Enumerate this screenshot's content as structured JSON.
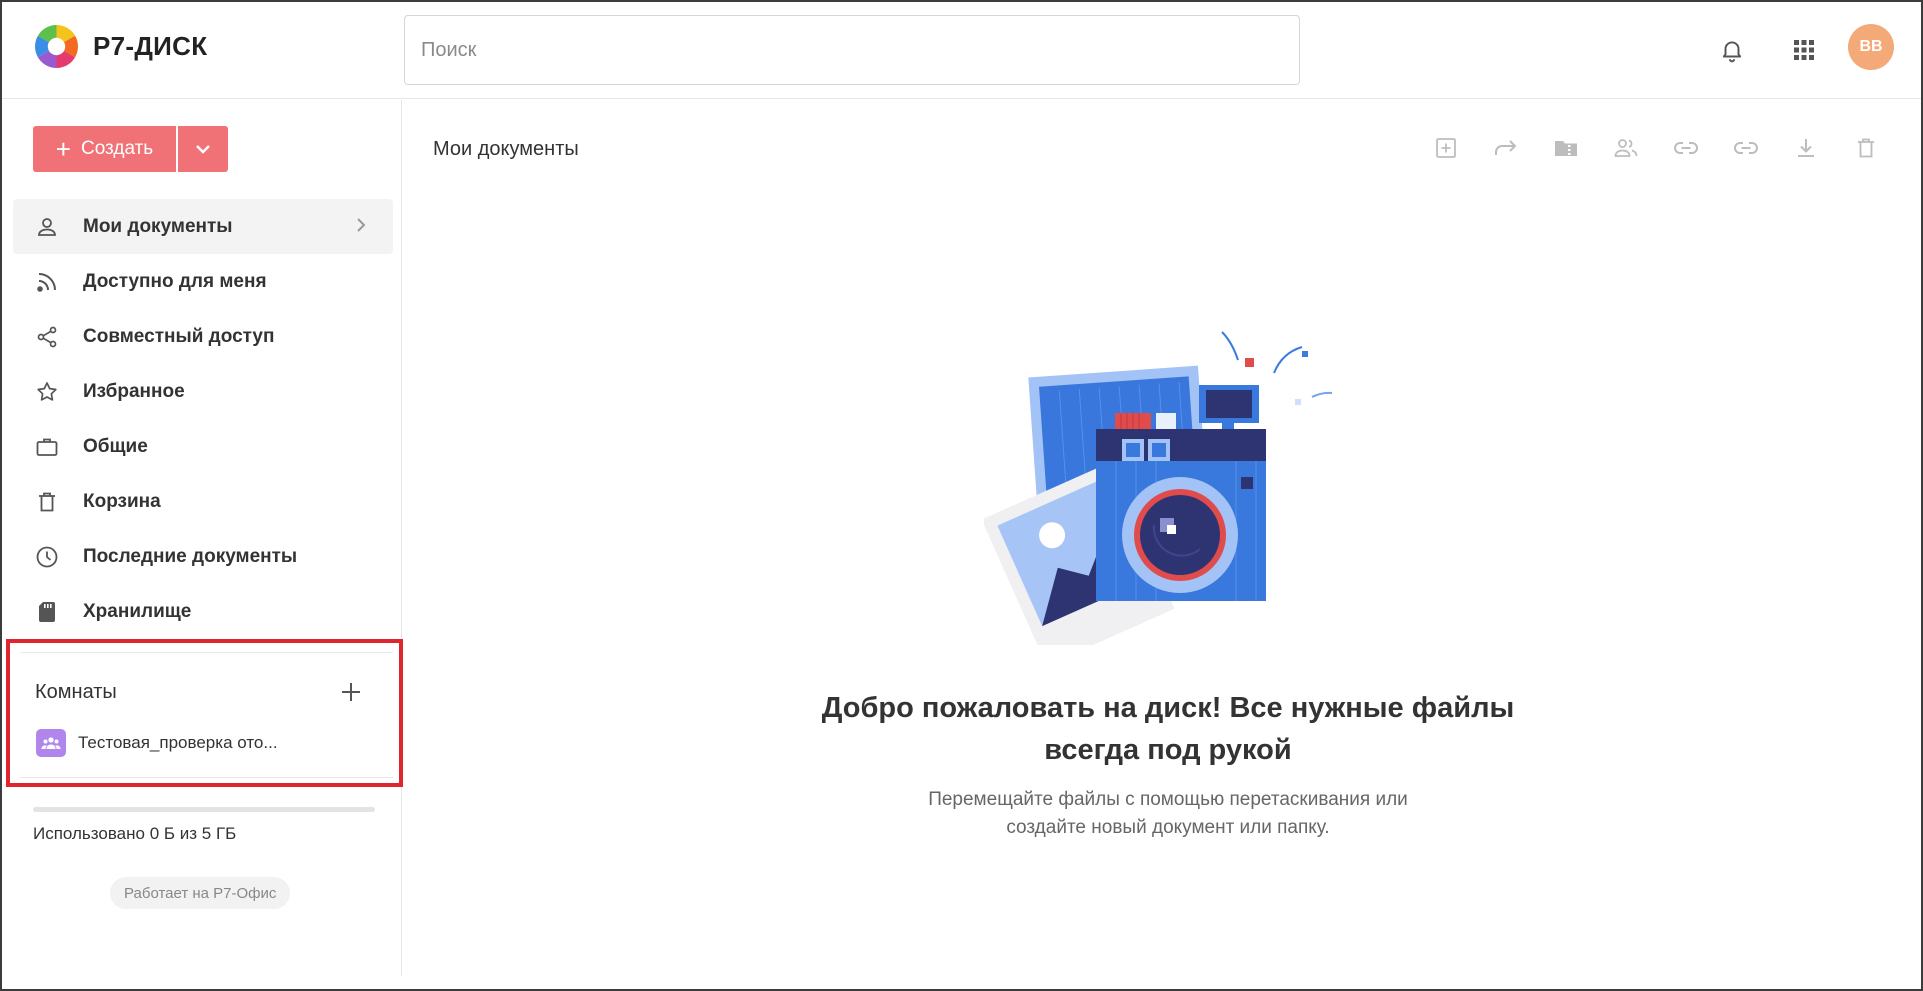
{
  "app": {
    "name": "Р7-ДИСК",
    "search_placeholder": "Поиск",
    "avatar_initials": "ВВ"
  },
  "sidebar": {
    "create_label": "Создать",
    "items": [
      {
        "label": "Мои документы",
        "icon": "person-icon",
        "active": true
      },
      {
        "label": "Доступно для меня",
        "icon": "rss-icon"
      },
      {
        "label": "Совместный доступ",
        "icon": "share-icon"
      },
      {
        "label": "Избранное",
        "icon": "star-icon"
      },
      {
        "label": "Общие",
        "icon": "briefcase-icon"
      },
      {
        "label": "Корзина",
        "icon": "trash-icon"
      },
      {
        "label": "Последние документы",
        "icon": "clock-icon"
      },
      {
        "label": "Хранилище",
        "icon": "sd-card-icon"
      }
    ],
    "rooms": {
      "title": "Комнаты",
      "items": [
        {
          "label": "Тестовая_проверка ото..."
        }
      ]
    },
    "usage_text": "Использовано 0 Б из 5 ГБ",
    "usage_fraction": 0,
    "powered_by": "Работает на Р7-Офис"
  },
  "main": {
    "title": "Мои документы",
    "toolbar": [
      "new-item-icon",
      "move-icon",
      "archive-folder-icon",
      "share-users-icon",
      "link-icon",
      "link-icon",
      "download-icon",
      "delete-icon"
    ],
    "empty_title": "Добро пожаловать на диск! Все нужные файлы всегда под рукой",
    "empty_desc": "Перемещайте файлы с помощью перетаскивания или создайте новый документ или папку."
  },
  "colors": {
    "accent": "#f07276",
    "avatar": "#f4a978",
    "room_icon": "#b086ec",
    "highlight_box": "#e0252e"
  }
}
